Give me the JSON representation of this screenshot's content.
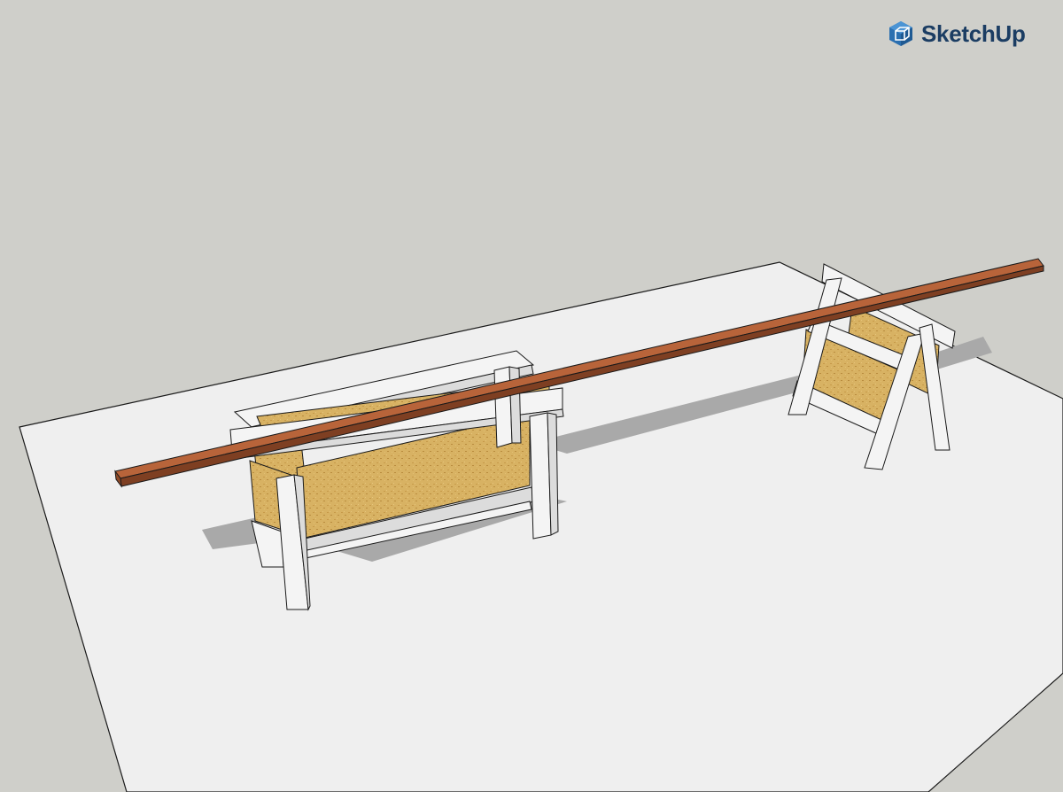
{
  "app": {
    "brand_name": "SketchUp",
    "logo_icon": "sketchup-logo-icon"
  },
  "colors": {
    "sky": "#cfcfca",
    "ground": "#efefef",
    "edge": "#1a1a1a",
    "shadow": "#a9a9a9",
    "white_frame": "#f4f4f4",
    "frame_side": "#dcdcdc",
    "osb": "#d8b263",
    "board_top": "#b8643a",
    "board_side": "#7e3f22",
    "brand": "#1b3d63"
  },
  "scene": {
    "objects": [
      "ground-plane",
      "workbench",
      "sawhorse",
      "long-board"
    ]
  }
}
